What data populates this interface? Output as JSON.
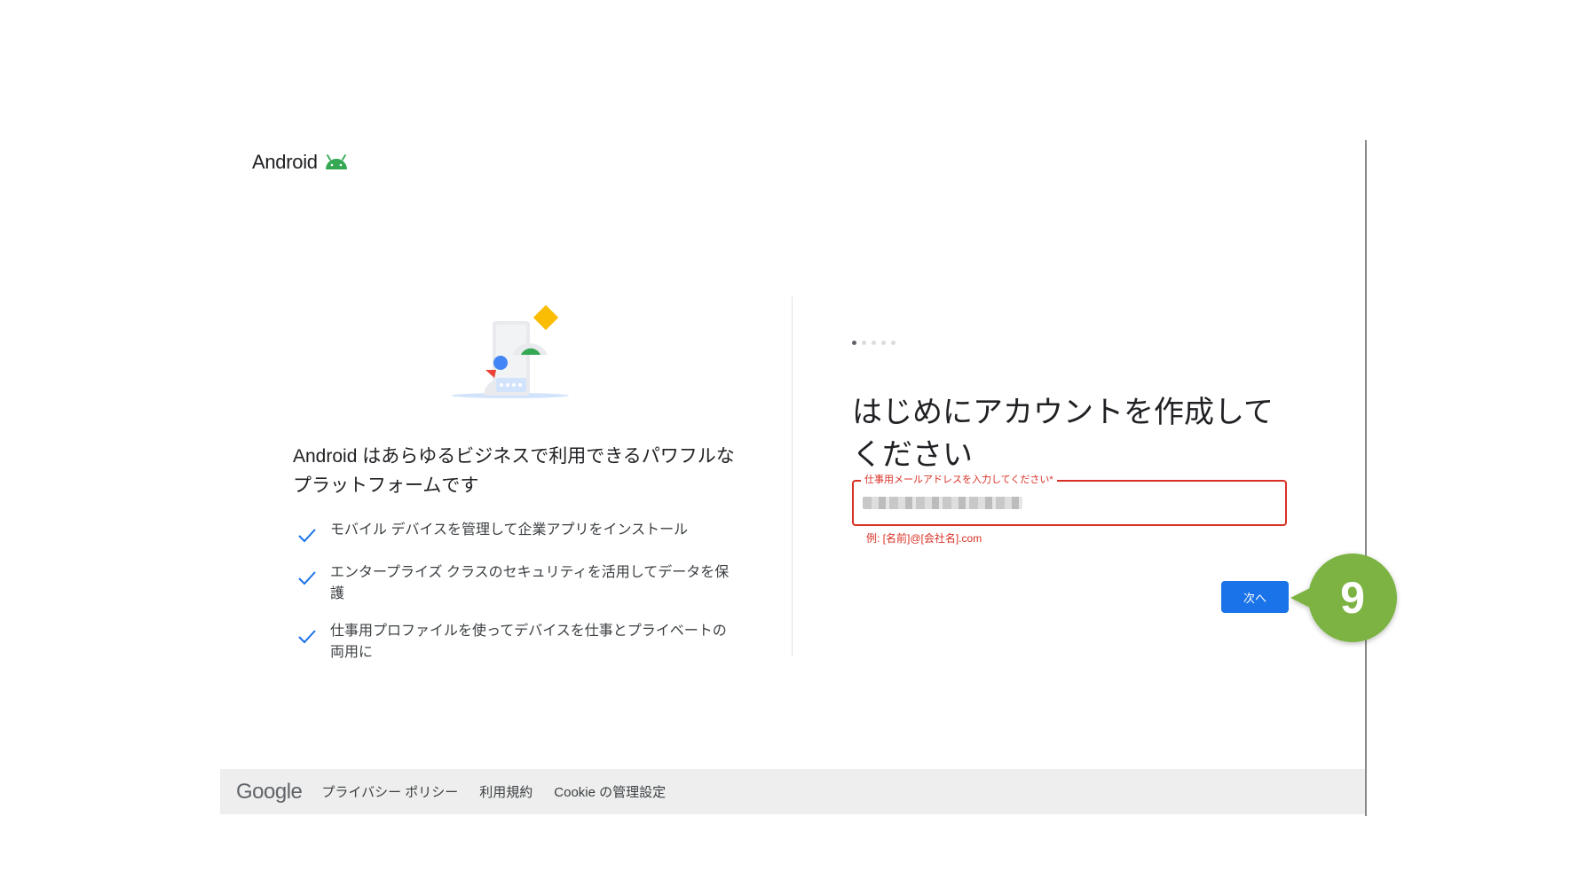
{
  "header": {
    "logo_text": "Android"
  },
  "left": {
    "heading": "Android はあらゆるビジネスで利用できるパワフルなプラットフォームです",
    "features": [
      "モバイル デバイスを管理して企業アプリをインストール",
      "エンタープライズ クラスのセキュリティを活用してデータを保護",
      "仕事用プロファイルを使ってデバイスを仕事とプライベートの両用に"
    ]
  },
  "form": {
    "steps_total": 5,
    "current_step": 1,
    "heading": "はじめにアカウントを作成してください",
    "email_label": "仕事用メールアドレスを入力してください*",
    "email_hint": "例: [名前]@[会社名].com",
    "next_label": "次へ"
  },
  "callout": {
    "number": "9",
    "color": "#7cb342"
  },
  "footer": {
    "logo": "Google",
    "links": [
      "プライバシー ポリシー",
      "利用規約",
      "Cookie の管理設定"
    ]
  },
  "colors": {
    "primary": "#1a73e8",
    "error": "#d93025",
    "android_green": "#34a853"
  }
}
